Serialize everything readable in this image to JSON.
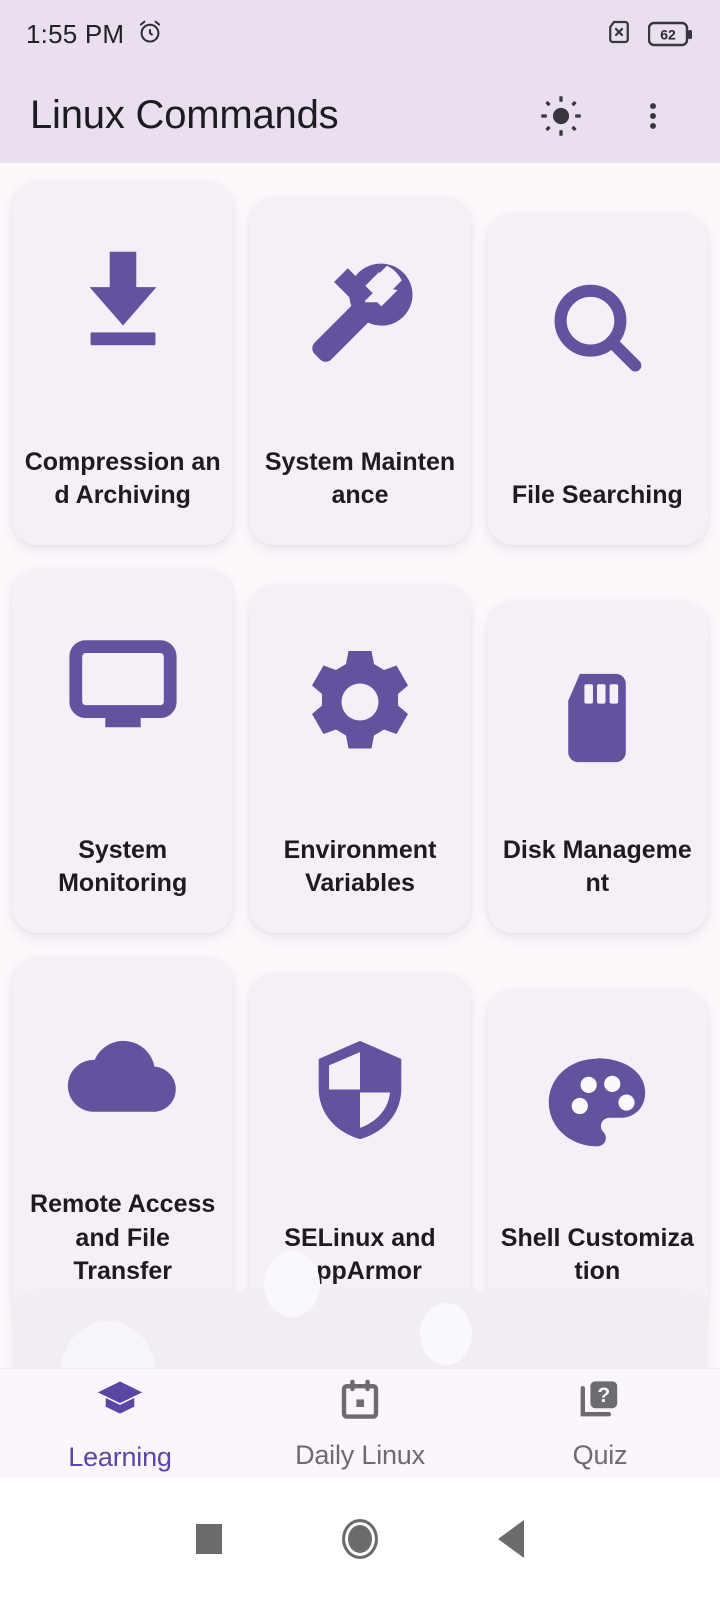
{
  "statusbar": {
    "time": "1:55 PM",
    "alarm_icon": "alarm-clock-icon",
    "sim_icon": "no-sim-icon",
    "battery_level": "62",
    "battery_icon": "battery-icon"
  },
  "appbar": {
    "title": "Linux Commands",
    "brightness_icon": "brightness-sun-icon",
    "overflow_icon": "more-vertical-icon"
  },
  "colors": {
    "accent_purple": "#65529F",
    "appbar_bg": "#E9DFEF",
    "page_bg": "#FCF8FC",
    "card_bg": "#F5F0F7",
    "nav_active": "#5A46A5",
    "nav_inactive": "#6E6A72",
    "text_primary": "#1D1B20"
  },
  "grid": {
    "cards": [
      {
        "label": "Compression and Archiving",
        "icon": "archive-download-icon"
      },
      {
        "label": "System Maintenance",
        "icon": "wrench-icon"
      },
      {
        "label": "File Searching",
        "icon": "search-magnifier-icon"
      },
      {
        "label": "System Monitoring",
        "icon": "monitor-icon"
      },
      {
        "label": "Environment Variables",
        "icon": "gear-icon"
      },
      {
        "label": "Disk Management",
        "icon": "sd-card-icon"
      },
      {
        "label": "Remote Access and File Transfer",
        "icon": "cloud-icon"
      },
      {
        "label": "SELinux and AppArmor",
        "icon": "shield-icon"
      },
      {
        "label": "Shell Customization",
        "icon": "palette-icon"
      }
    ]
  },
  "bottomnav": {
    "items": [
      {
        "label": "Learning",
        "icon": "graduation-cap-icon",
        "active": true
      },
      {
        "label": "Daily Linux",
        "icon": "calendar-icon",
        "active": false
      },
      {
        "label": "Quiz",
        "icon": "quiz-question-icon",
        "active": false
      }
    ]
  },
  "systemnav": {
    "recents_icon": "square-recents-icon",
    "home_icon": "circle-home-icon",
    "back_icon": "triangle-back-icon"
  }
}
